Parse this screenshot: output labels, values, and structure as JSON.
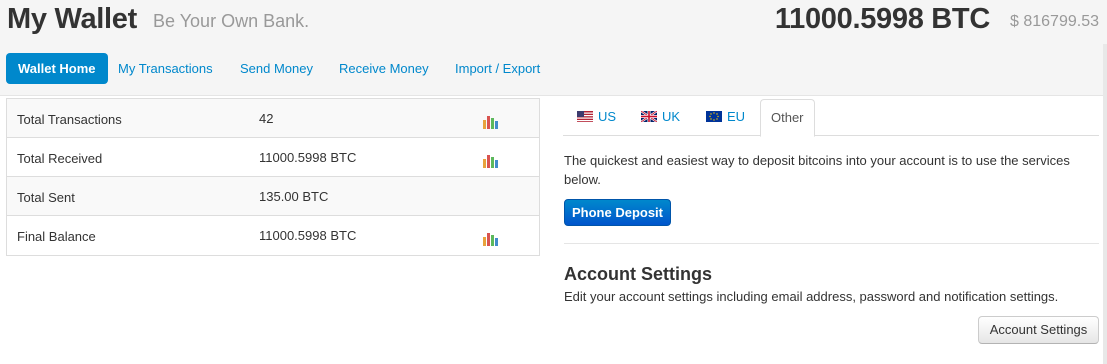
{
  "header": {
    "title": "My Wallet",
    "tagline": "Be Your Own Bank.",
    "balance_btc": "11000.5998 BTC",
    "balance_usd": "$ 816799.53"
  },
  "nav": {
    "items": [
      {
        "label": "Wallet Home",
        "active": true
      },
      {
        "label": "My Transactions"
      },
      {
        "label": "Send Money"
      },
      {
        "label": "Receive Money"
      },
      {
        "label": "Import / Export"
      }
    ]
  },
  "stats": {
    "rows": [
      {
        "label": "Total Transactions",
        "value": "42",
        "chart": true
      },
      {
        "label": "Total Received",
        "value": "11000.5998 BTC",
        "chart": true
      },
      {
        "label": "Total Sent",
        "value": "135.00 BTC",
        "chart": false
      },
      {
        "label": "Final Balance",
        "value": "11000.5998 BTC",
        "chart": true
      }
    ]
  },
  "tabs": [
    {
      "label": "US",
      "icon": "us-flag-icon"
    },
    {
      "label": "UK",
      "icon": "uk-flag-icon"
    },
    {
      "label": "EU",
      "icon": "eu-flag-icon"
    },
    {
      "label": "Other",
      "active": true
    }
  ],
  "deposit": {
    "text": "The quickest and easiest way to deposit bitcoins into your account is to use the services below.",
    "button": "Phone Deposit"
  },
  "settings": {
    "heading": "Account Settings",
    "description": "Edit your account settings including email address, password and notification settings.",
    "button": "Account Settings"
  },
  "colors": {
    "accent": "#0088cc",
    "header_bg": "#f5f5f5"
  }
}
